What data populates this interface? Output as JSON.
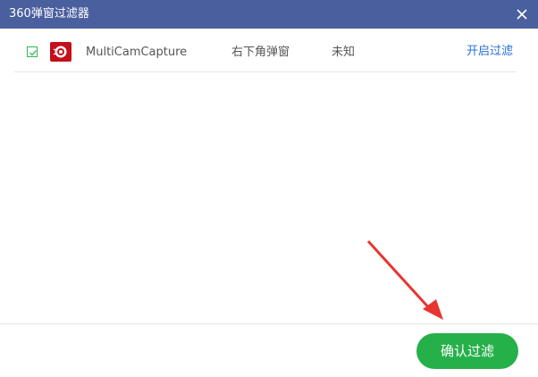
{
  "window": {
    "title": "360弹窗过滤器"
  },
  "colors": {
    "titlebar": "#4a5f9e",
    "link": "#2a6fd6",
    "confirm": "#26b04a",
    "checkbox": "#2fb84f",
    "app_icon": "#c4101a",
    "annotation": "#e8342f"
  },
  "icons": {
    "close": "close-icon",
    "checkbox": "checkmark-icon",
    "app": "multicamcapture-app-icon",
    "annotation": "red-arrow-annotation"
  },
  "list": {
    "items": [
      {
        "checked": true,
        "name": "MultiCamCapture",
        "position": "右下角弹窗",
        "type": "未知",
        "action": "开启过滤"
      }
    ]
  },
  "footer": {
    "confirm_label": "确认过滤"
  }
}
